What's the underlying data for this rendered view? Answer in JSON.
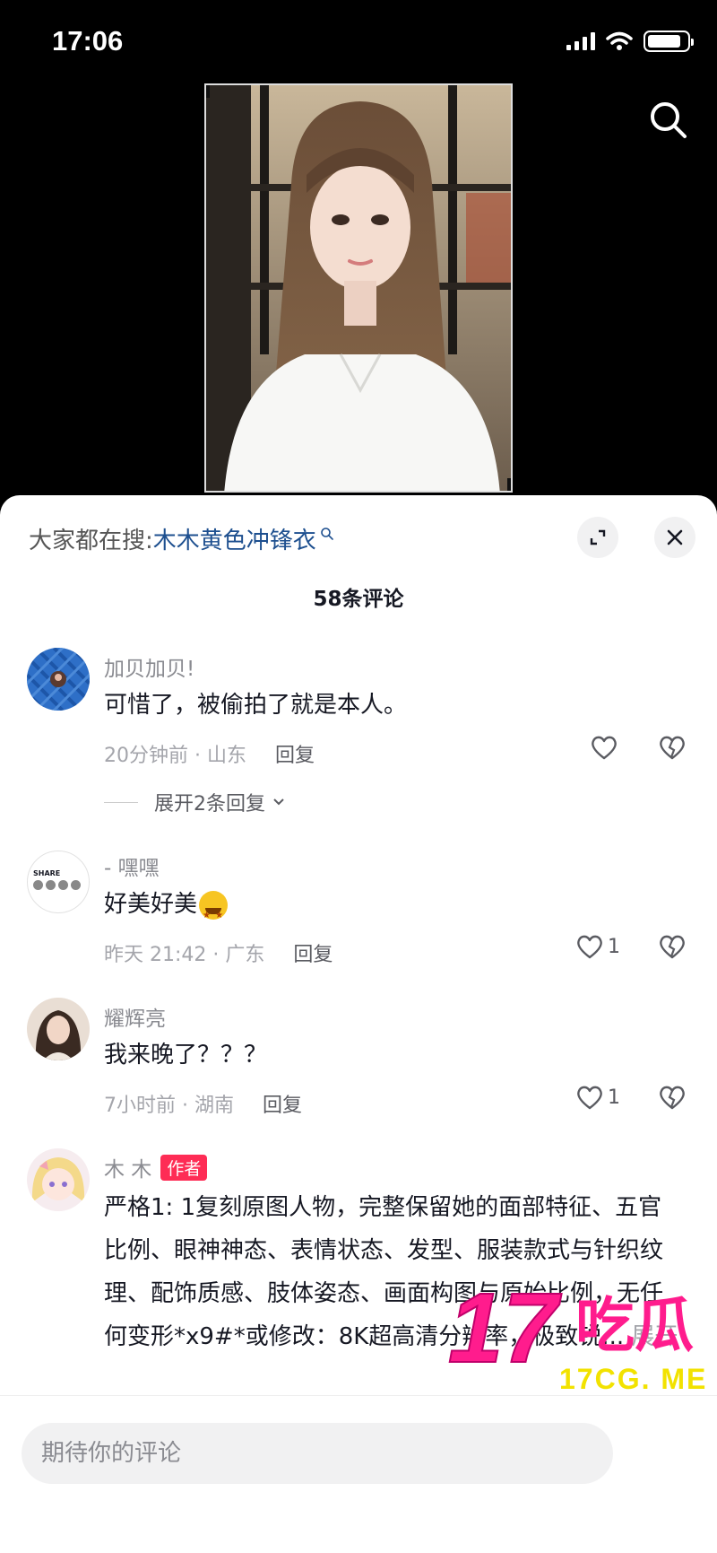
{
  "status_bar": {
    "time": "17:06"
  },
  "trending": {
    "prefix": "大家都在搜:",
    "keyword": "木木黄色冲锋衣"
  },
  "comment_count": "58条评论",
  "comments": [
    {
      "username": "加贝加贝!",
      "text": "可惜了，被偷拍了就是本人。",
      "time_location": "20分钟前 · 山东",
      "reply_label": "回复",
      "likes": "",
      "expand_label": "展开2条回复"
    },
    {
      "username": "- 嘿嘿",
      "text": "好美好美",
      "time_location": "昨天 21:42 · 广东",
      "reply_label": "回复",
      "likes": "1",
      "avatar_text": "SHARE"
    },
    {
      "username": "耀辉亮",
      "text": "我来晚了？？？",
      "time_location": "7小时前 · 湖南",
      "reply_label": "回复",
      "likes": "1"
    },
    {
      "username": "木 木",
      "author_badge": "作者",
      "text": "严格1: 1复刻原图人物，完整保留她的面部特征、五官比例、眼神神态、表情状态、发型、服装款式与针织纹理、配饰质感、肢体姿态、画面构图与原始比例，无任何变形*x9#*或修改：8K超高清分辨率，极致锐...",
      "more_label": "展开"
    }
  ],
  "input": {
    "placeholder": "期待你的评论"
  },
  "watermark": {
    "brand": "17吃瓜",
    "url": "17CG. ME"
  },
  "colors": {
    "accent": "#fe2c55",
    "keyword": "#1d4f8f",
    "watermark_pink": "#ff1c8d",
    "watermark_yellow": "#f2e200"
  },
  "icons": [
    "search-icon",
    "expand-icon",
    "close-icon",
    "heart-icon",
    "broken-heart-icon",
    "chevron-down-icon"
  ]
}
